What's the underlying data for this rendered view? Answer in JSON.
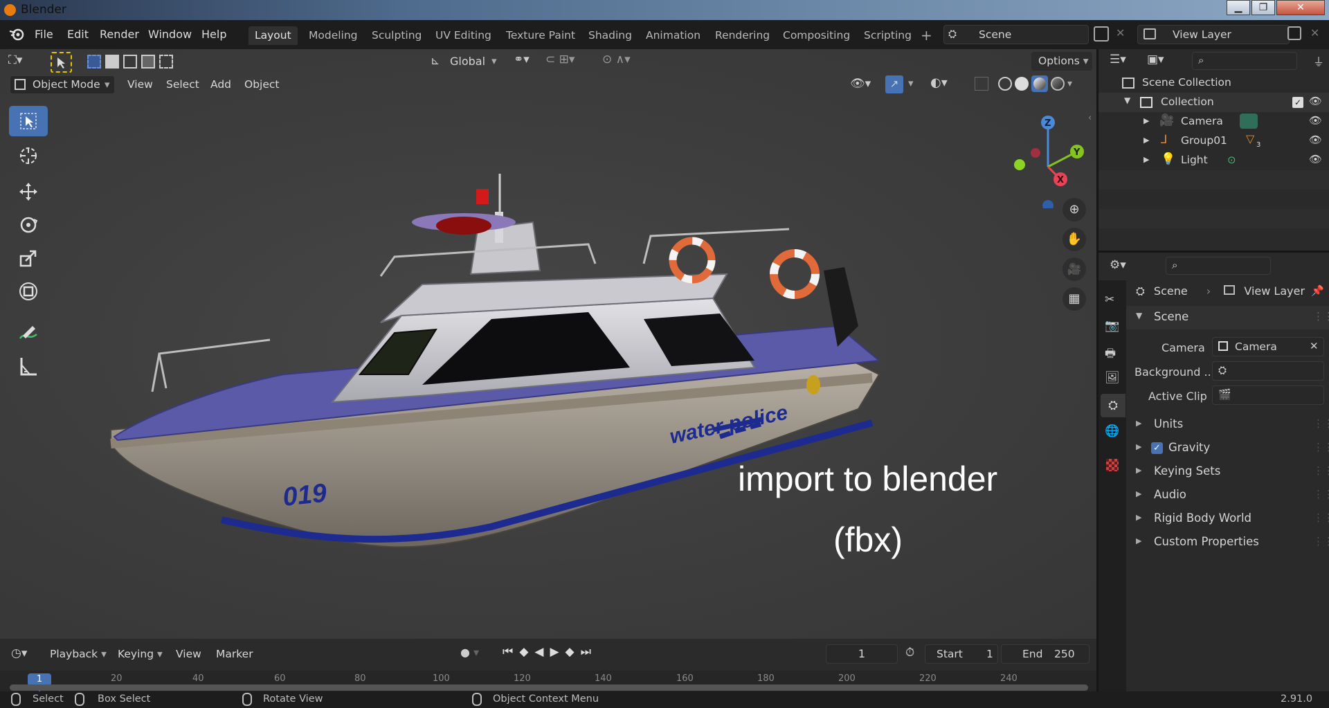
{
  "app": {
    "title": "Blender",
    "version": "2.91.0"
  },
  "menu": [
    "File",
    "Edit",
    "Render",
    "Window",
    "Help"
  ],
  "workspaces": [
    "Layout",
    "Modeling",
    "Sculpting",
    "UV Editing",
    "Texture Paint",
    "Shading",
    "Animation",
    "Rendering",
    "Compositing",
    "Scripting"
  ],
  "active_workspace": "Layout",
  "scene_name": "Scene",
  "view_layer_name": "View Layer",
  "viewport": {
    "orientation": "Global",
    "options_label": "Options",
    "mode": "Object Mode",
    "header_menus": [
      "View",
      "Select",
      "Add",
      "Object"
    ],
    "overlay_text_line1": "import to blender",
    "overlay_text_line2": "(fbx)",
    "hull_number": "019",
    "hull_text": "water police",
    "gizmo_axes": {
      "z": "Z",
      "y": "Y",
      "x": "X"
    }
  },
  "outliner": {
    "root": "Scene Collection",
    "collection": "Collection",
    "items": [
      {
        "label": "Camera",
        "icon": "camera-icon"
      },
      {
        "label": "Group01",
        "icon": "empty-icon"
      },
      {
        "label": "Light",
        "icon": "light-icon"
      }
    ],
    "group_badge": "3"
  },
  "properties": {
    "breadcrumb_scene": "Scene",
    "breadcrumb_view_layer": "View Layer",
    "scene_panel": "Scene",
    "camera_label": "Camera",
    "camera_value": "Camera",
    "background_label": "Background ...",
    "active_clip_label": "Active Clip",
    "panels": [
      "Units",
      "Gravity",
      "Keying Sets",
      "Audio",
      "Rigid Body World",
      "Custom Properties"
    ],
    "gravity_checked": true
  },
  "timeline": {
    "menus": [
      "Playback",
      "Keying",
      "View",
      "Marker"
    ],
    "current_frame": "1",
    "start_label": "Start",
    "start_value": "1",
    "end_label": "End",
    "end_value": "250",
    "ticks": [
      "1",
      "20",
      "40",
      "60",
      "80",
      "100",
      "120",
      "140",
      "160",
      "180",
      "200",
      "220",
      "240"
    ]
  },
  "status": {
    "select": "Select",
    "box_select": "Box Select",
    "rotate_view": "Rotate View",
    "context_menu": "Object Context Menu"
  },
  "colors": {
    "accent": "#4772b3",
    "viewport_bg": "#3d3d3d",
    "panel_bg": "#2a2a2a",
    "hull_blue": "#1d2a8f",
    "deck_purple": "#5a5aa8"
  }
}
